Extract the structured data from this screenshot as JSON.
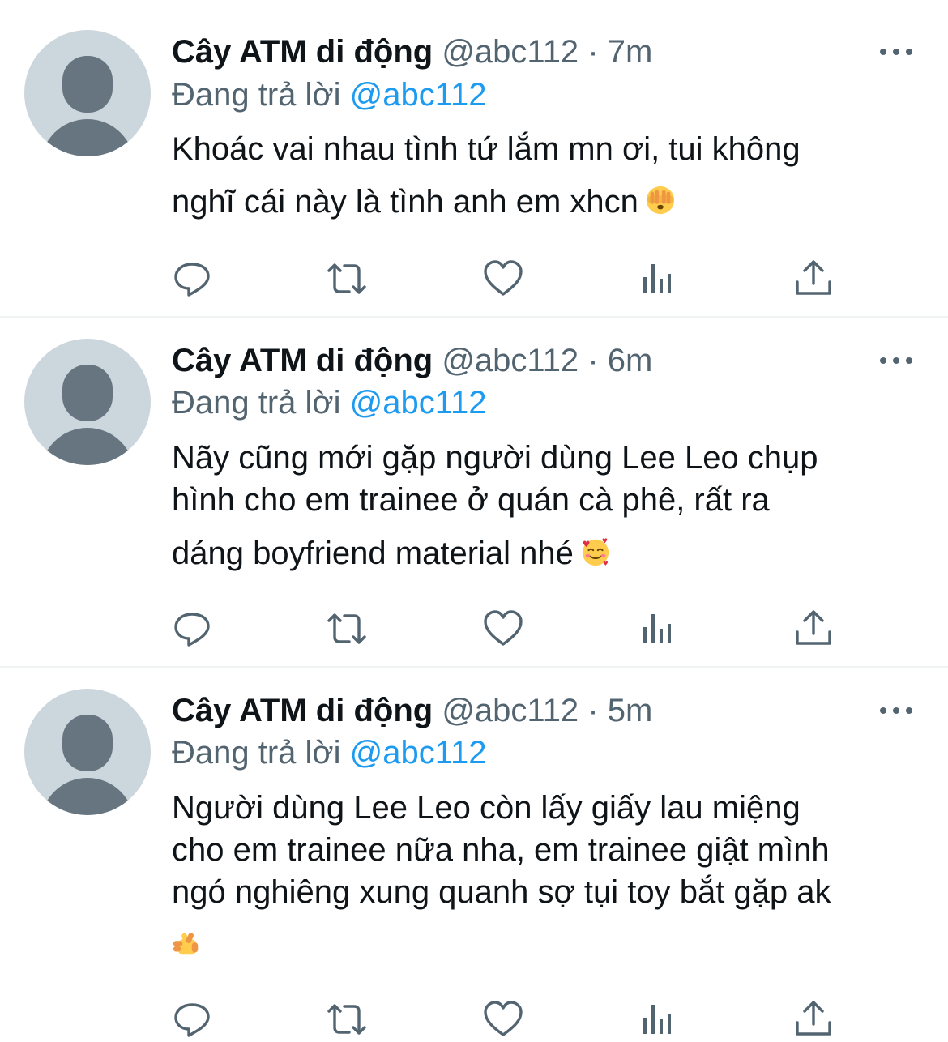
{
  "tweets": [
    {
      "display_name": "Cây ATM di động",
      "handle": "@abc112",
      "separator": "·",
      "time": "7m",
      "reply_prefix": "Đang trả lời",
      "reply_to": "@abc112",
      "text_lines": [
        "Khoác vai nhau tình tứ lắm mn ơi, tui không",
        "nghĩ cái này là tình anh em xhcn"
      ],
      "emoji": "face-with-peeking-eye"
    },
    {
      "display_name": "Cây ATM di động",
      "handle": "@abc112",
      "separator": "·",
      "time": "6m",
      "reply_prefix": "Đang trả lời",
      "reply_to": "@abc112",
      "text_lines": [
        "Nãy cũng mới gặp người dùng Lee Leo chụp",
        "hình cho em trainee ở quán cà phê, rất ra",
        "dáng boyfriend material nhé"
      ],
      "emoji": "smiling-face-with-hearts"
    },
    {
      "display_name": "Cây ATM di động",
      "handle": "@abc112",
      "separator": "·",
      "time": "5m",
      "reply_prefix": "Đang trả lời",
      "reply_to": "@abc112",
      "text_lines": [
        "Người dùng Lee Leo còn lấy giấy lau miệng",
        "cho em trainee nữa nha, em trainee giật mình",
        "ngó nghiêng xung quanh sợ tụi toy bắt gặp ak",
        ""
      ],
      "emoji": "hand-with-index-finger-and-thumb-crossed"
    }
  ],
  "icons": {
    "more": "more-horizontal-icon",
    "reply": "reply-icon",
    "retweet": "retweet-icon",
    "like": "heart-icon",
    "views": "analytics-icon",
    "share": "share-icon"
  },
  "colors": {
    "text": "#0f1419",
    "secondary": "#536471",
    "accent": "#1d9bf0",
    "avatar_bg": "#ccd6dd",
    "avatar_fg": "#66757f",
    "separator": "#eff3f4"
  }
}
